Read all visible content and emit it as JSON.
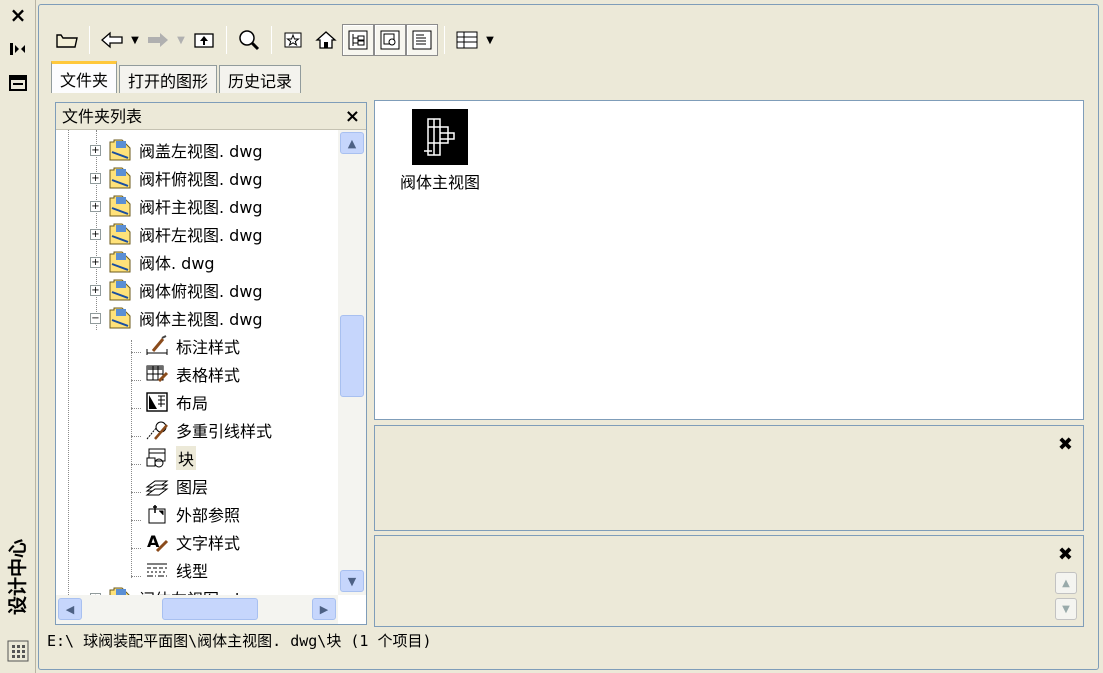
{
  "palette": {
    "title": "设计中心",
    "close_glyph": "×"
  },
  "toolbar": {
    "buttons": [
      "load-icon",
      "back-icon",
      "forward-icon",
      "up-icon",
      "search-icon",
      "favorites-icon",
      "home-icon",
      "tree-toggle-icon",
      "preview-icon",
      "description-icon",
      "views-icon"
    ]
  },
  "tabs": [
    {
      "label": "文件夹",
      "active": true
    },
    {
      "label": "打开的图形",
      "active": false
    },
    {
      "label": "历史记录",
      "active": false
    }
  ],
  "folder_panel": {
    "title": "文件夹列表",
    "close_glyph": "×",
    "drawings": [
      {
        "label": "阀盖左视图. dwg"
      },
      {
        "label": "阀杆俯视图. dwg"
      },
      {
        "label": "阀杆主视图. dwg"
      },
      {
        "label": "阀杆左视图. dwg"
      },
      {
        "label": "阀体. dwg"
      },
      {
        "label": "阀体俯视图. dwg"
      },
      {
        "label": "阀体主视图. dwg"
      }
    ],
    "children": [
      {
        "label": "标注样式",
        "icon": "dimension-style-icon"
      },
      {
        "label": "表格样式",
        "icon": "table-style-icon"
      },
      {
        "label": "布局",
        "icon": "layout-icon"
      },
      {
        "label": "多重引线样式",
        "icon": "multileader-style-icon"
      },
      {
        "label": "块",
        "icon": "block-icon",
        "selected": true
      },
      {
        "label": "图层",
        "icon": "layer-icon"
      },
      {
        "label": "外部参照",
        "icon": "xref-icon"
      },
      {
        "label": "文字样式",
        "icon": "text-style-icon"
      },
      {
        "label": "线型",
        "icon": "linetype-icon"
      }
    ],
    "partial_next": "阀体左视图. dwg"
  },
  "content": {
    "items": [
      {
        "label": "阀体主视图"
      }
    ]
  },
  "status": "E:\\ 球阀装配平面图\\阀体主视图. dwg\\块 (1 个项目)"
}
